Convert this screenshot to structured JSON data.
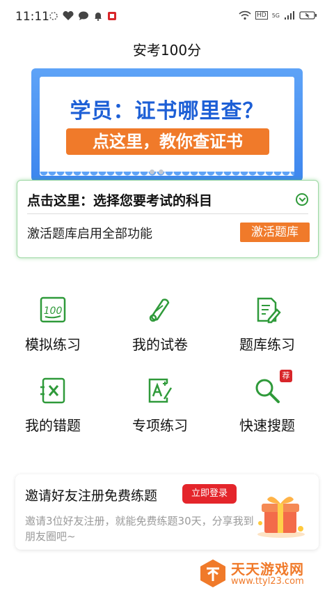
{
  "status_bar": {
    "time": "11:11",
    "network_label": "HD",
    "signal_label": "5G"
  },
  "app": {
    "title": "安考100分"
  },
  "banner": {
    "title": "学员：证书哪里查？",
    "subtitle": "点这里，教你查证书"
  },
  "subject_card": {
    "title": "点击这里：选择您要考试的科目",
    "description": "激活题库启用全部功能",
    "button_label": "激活题库"
  },
  "grid": [
    {
      "label": "模拟练习",
      "icon": "score-100-icon"
    },
    {
      "label": "我的试卷",
      "icon": "scroll-icon"
    },
    {
      "label": "题库练习",
      "icon": "document-edit-icon"
    },
    {
      "label": "我的错题",
      "icon": "wrong-answer-icon"
    },
    {
      "label": "专项练习",
      "icon": "a-plus-icon"
    },
    {
      "label": "快速搜题",
      "icon": "search-icon",
      "badge": "荐"
    }
  ],
  "invite": {
    "title": "邀请好友注册免费练题",
    "button_label": "立即登录",
    "description": "邀请3位好友注册，就能免费练题30天，分享我到朋友圈吧~"
  },
  "watermark": {
    "title": "天天游戏网",
    "url": "www.ttyl23.com"
  },
  "colors": {
    "accent_green": "#2f9a3a",
    "accent_orange": "#f07a2a",
    "banner_blue": "#1d5fd6",
    "red": "#e4252b"
  }
}
